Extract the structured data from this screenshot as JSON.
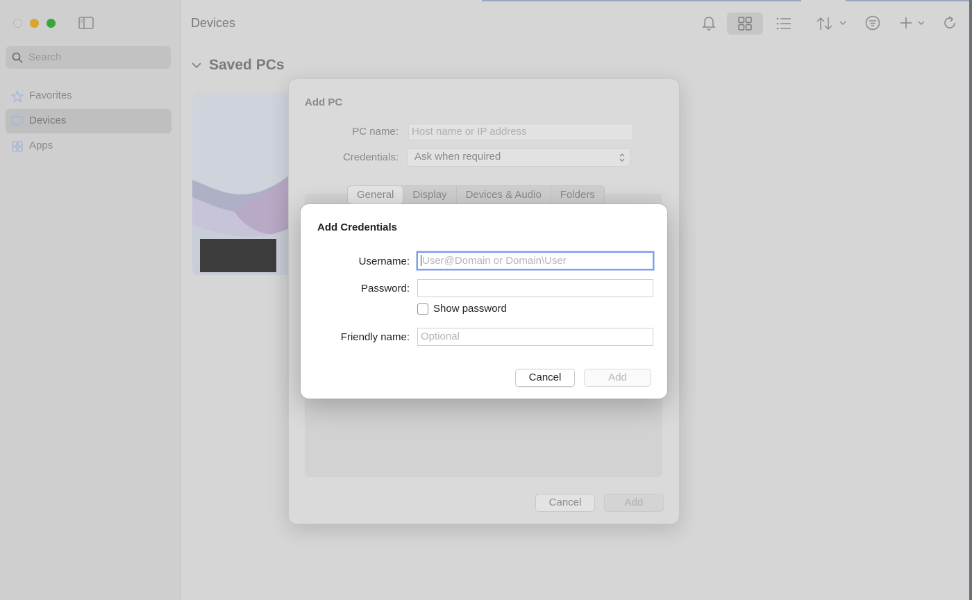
{
  "app": {
    "window_title": "Devices"
  },
  "sidebar": {
    "search_placeholder": "Search",
    "items": [
      {
        "label": "Favorites",
        "icon": "star-icon"
      },
      {
        "label": "Devices",
        "icon": "monitor-icon",
        "selected": true
      },
      {
        "label": "Apps",
        "icon": "grid-icon"
      }
    ]
  },
  "toolbar": {
    "icons": [
      "bell-icon",
      "grid-view-icon",
      "list-view-icon",
      "sort-icon",
      "filter-icon",
      "add-icon",
      "refresh-icon"
    ]
  },
  "main": {
    "section_title": "Saved PCs"
  },
  "add_pc_dialog": {
    "title": "Add PC",
    "pc_name_label": "PC name:",
    "pc_name_placeholder": "Host name or IP address",
    "credentials_label": "Credentials:",
    "credentials_value": "Ask when required",
    "tabs": [
      "General",
      "Display",
      "Devices & Audio",
      "Folders"
    ],
    "cancel_label": "Cancel",
    "add_label": "Add"
  },
  "credentials_dialog": {
    "title": "Add Credentials",
    "username_label": "Username:",
    "username_placeholder": "User@Domain or Domain\\User",
    "password_label": "Password:",
    "show_password_label": "Show password",
    "friendly_name_label": "Friendly name:",
    "friendly_name_placeholder": "Optional",
    "cancel_label": "Cancel",
    "add_label": "Add"
  }
}
